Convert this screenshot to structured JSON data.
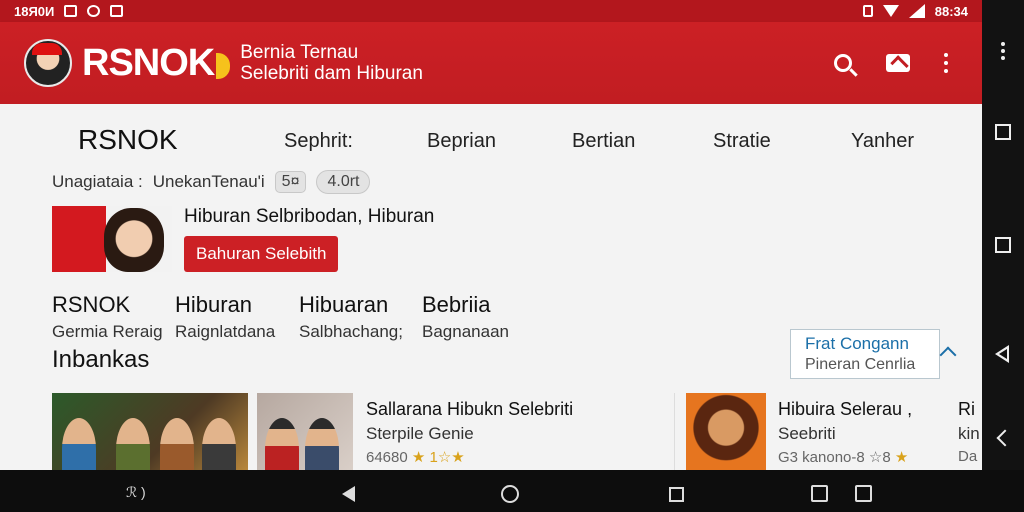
{
  "status_bar": {
    "time_left": "18Я0И",
    "time_right": "88:34"
  },
  "app_bar": {
    "brand": "RSNOK",
    "tagline_line1": "Bernia Ternau",
    "tagline_line2": "Selebriti dam Hiburan"
  },
  "tabs": [
    {
      "label": "RSNOK",
      "active": true
    },
    {
      "label": "Sephrit:"
    },
    {
      "label": "Beprian"
    },
    {
      "label": "Bertian"
    },
    {
      "label": "Stratie"
    },
    {
      "label": "Yanher"
    }
  ],
  "filter": {
    "label_left": "Unagiataia :",
    "label_right": "UnekanTenau'i",
    "chip_small": "5¤",
    "chip_round": "4.0rt"
  },
  "feature": {
    "title": "Hiburan Selbribodan, Hiburan",
    "button": "Bahuran Selebith"
  },
  "categories": [
    {
      "title": "RSNOK",
      "sub": "Germia Reraig"
    },
    {
      "title": "Hiburan",
      "sub": "Raignlatdana"
    },
    {
      "title": "Hibuaran",
      "sub": "Salbhachang;"
    },
    {
      "title": "Bebriia",
      "sub": "Bagnanaan"
    }
  ],
  "section_title": "Inbankas",
  "follow": {
    "title": "Frat Congann",
    "sub": "Pineran Cenrlia"
  },
  "cards": [
    {
      "title": "Sallarana Hibukn Selebriti",
      "sub": "Sterpile Genie",
      "meta": "64680",
      "stars": "★ 1☆★"
    },
    {
      "title": "Hibuira Selerau ,",
      "sub": "Seebriti",
      "meta": "G3 kanono-8 ☆8",
      "stars": "★"
    },
    {
      "title": "Ri",
      "sub": "kin",
      "meta": "Da"
    }
  ],
  "bottom_nav": {
    "label": "ℛ )"
  }
}
